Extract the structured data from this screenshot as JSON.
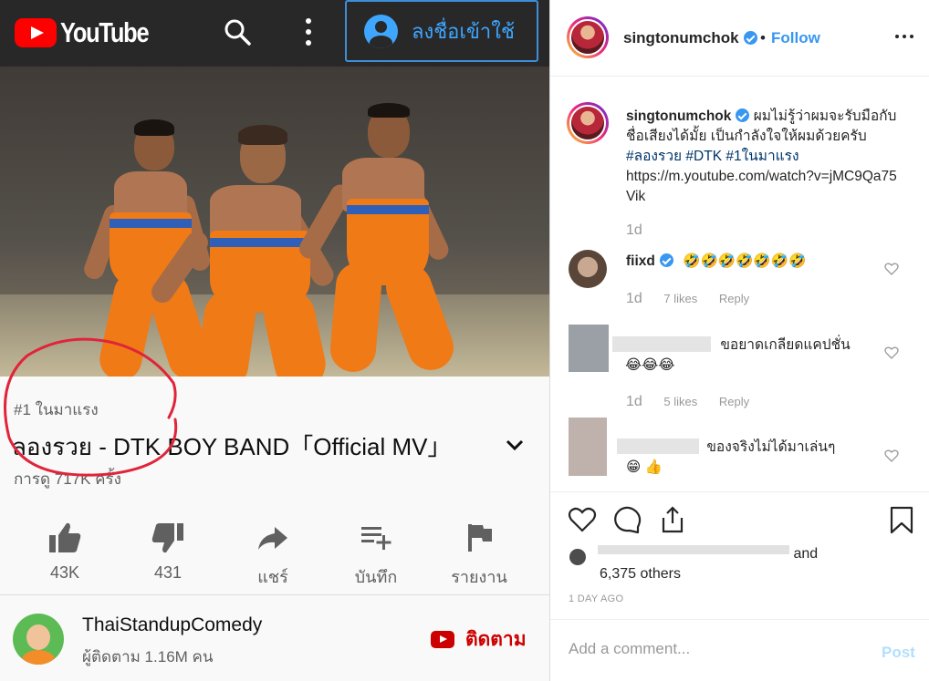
{
  "youtube": {
    "logo_text": "YouTube",
    "signin_label": "ลงชื่อเข้าใช้",
    "trending": "#1 ในมาแรง",
    "title": "ลองรวย - DTK BOY BAND「Official MV」",
    "views": "การดู 717K ครั้ง",
    "actions": [
      {
        "icon": "thumbs-up-icon",
        "label": "43K"
      },
      {
        "icon": "thumbs-down-icon",
        "label": "431"
      },
      {
        "icon": "share-icon",
        "label": "แชร์"
      },
      {
        "icon": "add-to-playlist-icon",
        "label": "บันทึก"
      },
      {
        "icon": "flag-icon",
        "label": "รายงาน"
      }
    ],
    "channel": {
      "name": "ThaiStandupComedy",
      "subscribers": "ผู้ติดตาม 1.16M คน",
      "subscribe_label": "ติดตาม"
    },
    "colors": {
      "brand_red": "#ff0000",
      "header_bg": "#282828",
      "signin_blue": "#3ea6ff",
      "annotation_red": "#e0243a"
    }
  },
  "instagram": {
    "username": "singtonumchok",
    "follow_label": "Follow",
    "dot": "•",
    "caption": {
      "username": "singtonumchok",
      "text": "ผมไม่รู้ว่าผมจะรับมือกับชื่อเสียงได้มั้ย เป็นกำลังใจให้ผมด้วยครับ",
      "hashtags": "#ลองรวย #DTK #1ในมาแรง",
      "url": "https://m.youtube.com/watch?v=jMC9Qa75Vik",
      "time": "1d"
    },
    "comments": [
      {
        "username": "fiixd",
        "text": "🤣🤣🤣🤣🤣🤣🤣",
        "time": "1d",
        "likes": "7 likes",
        "reply": "Reply"
      },
      {
        "username": "",
        "text": "ขอยาดเกลียดแคปชั่น",
        "emojis": "😂😂😂",
        "time": "1d",
        "likes": "5 likes",
        "reply": "Reply"
      },
      {
        "username": "",
        "text": "ของจริงไม่ได้มาเล่นๆ",
        "emojis": "😁 👍",
        "time": "",
        "likes": "",
        "reply": ""
      }
    ],
    "likes_suffix": "and",
    "likes_others": "6,375 others",
    "date": "1 DAY AGO",
    "add_comment_placeholder": "Add a comment...",
    "post_label": "Post",
    "colors": {
      "link": "#3897f0",
      "hashtag": "#003569",
      "verified": "#3897f0"
    }
  }
}
